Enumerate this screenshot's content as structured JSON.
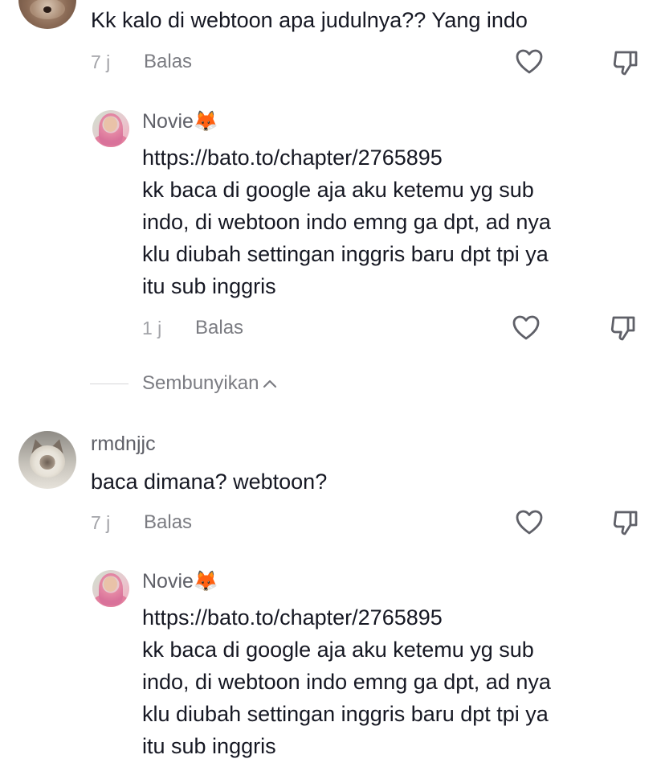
{
  "comments": [
    {
      "text_lines": [
        "Kk kalo di webtoon apa judulnya?? Yang indo"
      ],
      "time": "7 j",
      "reply_label": "Balas"
    },
    {
      "username": "Novie🦊",
      "text_lines": [
        "https://bato.to/chapter/2765895",
        "kk baca di google aja aku ketemu yg sub",
        "indo, di webtoon indo emng ga dpt, ad nya",
        "klu diubah settingan inggris baru dpt tpi ya",
        "itu sub inggris"
      ],
      "time": "1 j",
      "reply_label": "Balas"
    },
    {
      "username": "rmdnjjc",
      "text_lines": [
        "baca dimana? webtoon?"
      ],
      "time": "7 j",
      "reply_label": "Balas"
    },
    {
      "username": "Novie🦊",
      "text_lines": [
        "https://bato.to/chapter/2765895",
        "kk baca di google aja aku ketemu yg sub",
        "indo, di webtoon indo emng ga dpt, ad nya",
        "klu diubah settingan inggris baru dpt tpi ya",
        "itu sub inggris"
      ]
    }
  ],
  "hide_replies_label": "Sembunyikan",
  "icons": {
    "like": "heart-outline-icon",
    "dislike": "thumbs-down-outline-icon",
    "hide": "chevron-up-icon"
  },
  "colors": {
    "text_primary": "#161823",
    "text_secondary": "#7b7c82",
    "text_meta": "#a2a3a8"
  }
}
